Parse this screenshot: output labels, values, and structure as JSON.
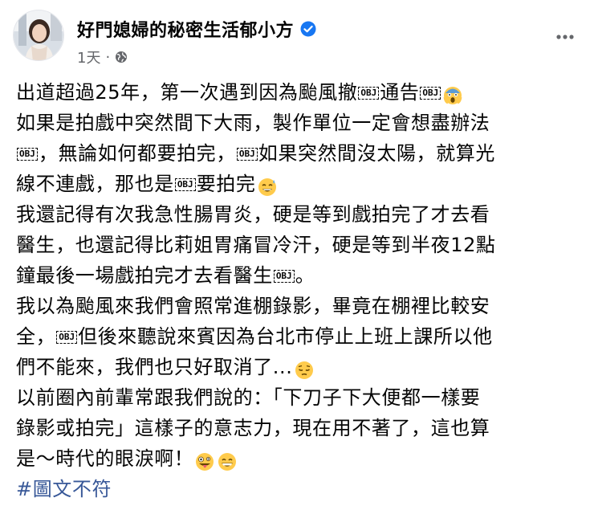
{
  "post": {
    "author": "好門媳婦的秘密生活郁小方",
    "time": "1天",
    "separator": "·",
    "icons": {
      "verified": "verified-badge-icon",
      "audience": "globe-icon",
      "more": "more-options-icon"
    },
    "colors": {
      "verified": "#1877f2",
      "hashtag": "#385898",
      "meta": "#65676b"
    },
    "lines": [
      [
        "出道超過25年，第一次遇到因為颱風撤",
        {
          "obj": "OBJ"
        },
        "通告",
        {
          "obj": "OBJ"
        },
        {
          "emoji": "scream"
        }
      ],
      [
        "如果是拍戲中突然間下大雨，製作單位一定會想盡辦法"
      ],
      [
        {
          "obj": "OBJ"
        },
        "，無論如何都要拍完，",
        {
          "obj": "OBJ"
        },
        "如果突然間沒太陽，就算光"
      ],
      [
        "線不連戲，那也是",
        {
          "obj": "OBJ"
        },
        "要拍完",
        {
          "emoji": "sweat-smile"
        }
      ],
      [
        "我還記得有次我急性腸胃炎，硬是等到戲拍完了才去看"
      ],
      [
        "醫生，也還記得比莉姐胃痛冒冷汗，硬是等到半夜12點"
      ],
      [
        "鐘最後一場戲拍完才去看醫生",
        {
          "obj": "OBJ"
        },
        "。"
      ],
      [
        "我以為颱風來我們會照常進棚錄影，畢竟在棚裡比較安"
      ],
      [
        "全，",
        {
          "obj": "OBJ"
        },
        "但後來聽說來賓因為台北市停止上班上課所以他"
      ],
      [
        "們不能來，我們也只好取消了...",
        {
          "emoji": "pensive"
        }
      ],
      [
        "以前圈內前輩常跟我們說的：「下刀子下大便都一樣要"
      ],
      [
        "錄影或拍完」這樣子的意志力，現在用不著了，這也算"
      ],
      [
        "是～時代的眼淚啊！",
        {
          "emoji": "zany"
        },
        {
          "emoji": "grin"
        }
      ]
    ],
    "hashtag": "#圖文不符"
  }
}
